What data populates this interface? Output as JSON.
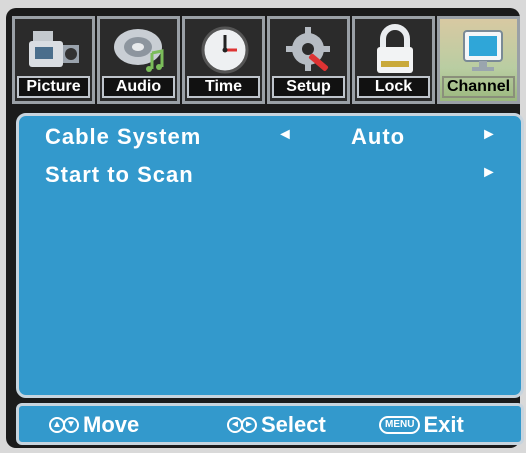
{
  "tabs": [
    {
      "label": "Picture",
      "icon": "camcorder-icon"
    },
    {
      "label": "Audio",
      "icon": "speaker-note-icon"
    },
    {
      "label": "Time",
      "icon": "clock-icon"
    },
    {
      "label": "Setup",
      "icon": "gear-wrench-icon"
    },
    {
      "label": "Lock",
      "icon": "padlock-icon"
    },
    {
      "label": "Channel",
      "icon": "monitor-icon",
      "active": true
    }
  ],
  "menu": {
    "items": [
      {
        "label": "Cable System",
        "value": "Auto",
        "left_arrow": "◄",
        "right_arrow": "►"
      },
      {
        "label": "Start to Scan",
        "value": "",
        "right_arrow": "►"
      }
    ]
  },
  "footer": {
    "move_label": "Move",
    "select_label": "Select",
    "exit_label": "Exit",
    "menu_key": "MENU"
  },
  "colors": {
    "panel": "#3399cc",
    "frame": "#1b1b1b",
    "active_tab": "#b9cda2"
  }
}
